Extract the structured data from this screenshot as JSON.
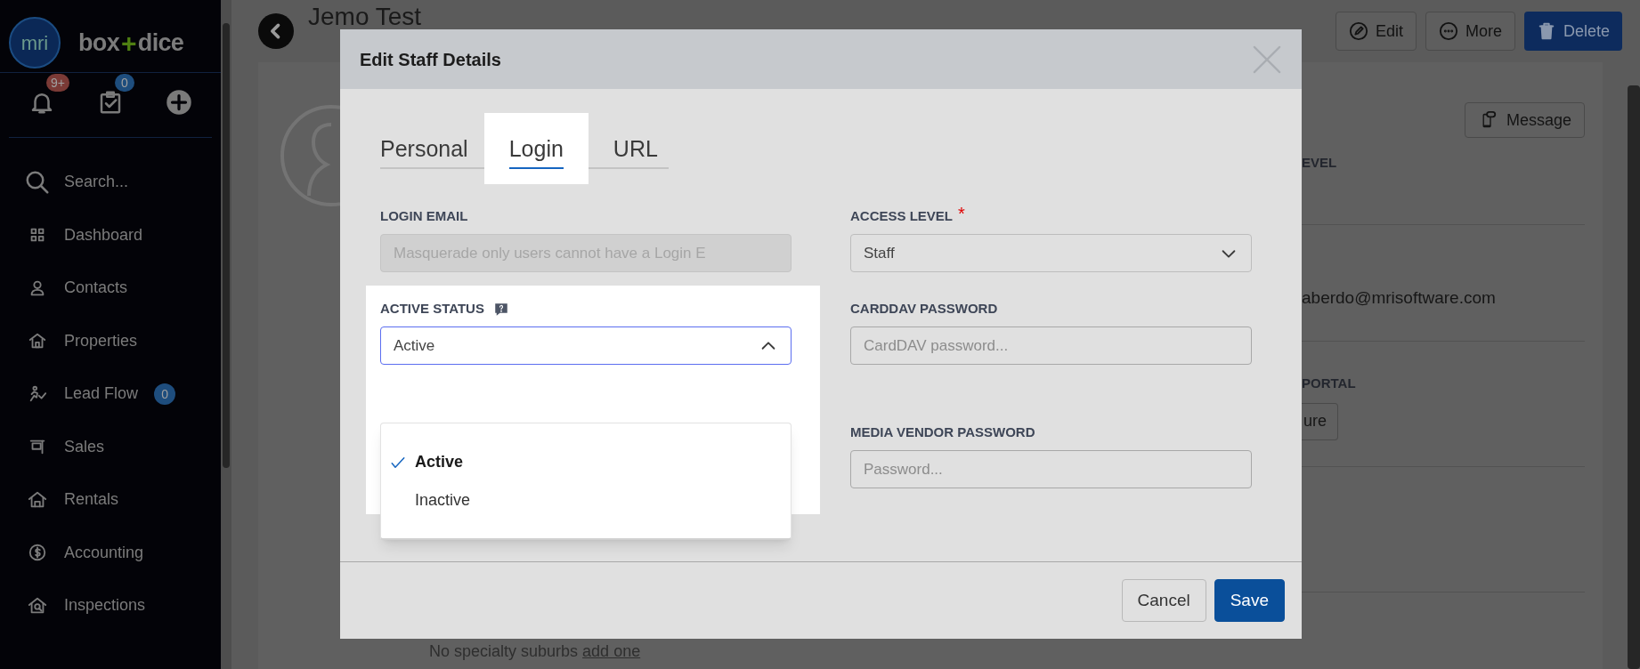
{
  "sidebar": {
    "logo": "mri",
    "brand": [
      {
        "text": "box",
        "color": "#7b7b7b"
      },
      {
        "text": "+",
        "color": "#4f7f12"
      },
      {
        "text": "dice",
        "color": "#7b7b7b"
      }
    ],
    "quick_actions": [
      {
        "kind": "bell",
        "badge": "9+",
        "color": "#7a3a36"
      },
      {
        "kind": "tasks",
        "badge": "0",
        "color": "#1e4d7d"
      },
      {
        "kind": "add"
      }
    ],
    "nav": [
      {
        "kind": "search",
        "label": "Search..."
      },
      {
        "kind": "dashboard",
        "label": "Dashboard"
      },
      {
        "kind": "contacts",
        "label": "Contacts"
      },
      {
        "kind": "properties",
        "label": "Properties"
      },
      {
        "kind": "leadflow",
        "label": "Lead Flow",
        "badge": "0"
      },
      {
        "kind": "sales",
        "label": "Sales"
      },
      {
        "kind": "rentals",
        "label": "Rentals"
      },
      {
        "kind": "accounting",
        "label": "Accounting"
      },
      {
        "kind": "inspections",
        "label": "Inspections"
      }
    ]
  },
  "page": {
    "title": "Jemo Test",
    "actions": [
      {
        "kind": "edit",
        "label": "Edit"
      },
      {
        "kind": "more",
        "label": "More"
      },
      {
        "kind": "delete",
        "label": "Delete"
      }
    ],
    "message_button": "Message",
    "sections": [
      {
        "label": "EVEL"
      },
      {
        "value": "aberdo@mrisoftware.com"
      },
      {
        "label": "PORTAL",
        "button": "ure"
      }
    ],
    "suburbs_text": "No specialty suburbs",
    "suburbs_link": "add one"
  },
  "modal": {
    "title": "Edit Staff Details",
    "tabs": [
      {
        "label": "Personal",
        "selected": false
      },
      {
        "label": "Login",
        "selected": true
      },
      {
        "label": "URL",
        "selected": false
      }
    ],
    "left_fields": [
      {
        "kind": "text",
        "label": "LOGIN EMAIL",
        "placeholder": "Masquerade only users cannot have a Login E",
        "disabled": true
      },
      {
        "kind": "select",
        "label": "ACTIVE STATUS",
        "help": true,
        "highlighted": true,
        "value": "Active",
        "expanded": true,
        "options": [
          {
            "label": "Active",
            "selected": true
          },
          {
            "label": "Inactive",
            "selected": false
          }
        ]
      }
    ],
    "right_fields": [
      {
        "kind": "select",
        "label": "ACCESS LEVEL",
        "required_mark": "*",
        "value": "Staff",
        "expanded": false
      },
      {
        "kind": "text",
        "label": "CARDDAV PASSWORD",
        "placeholder": "CardDAV password...",
        "disabled": false
      },
      {
        "kind": "text",
        "label": "MEDIA VENDOR PASSWORD",
        "placeholder": "Password...",
        "disabled": false
      }
    ],
    "buttons": [
      {
        "kind": "secondary",
        "label": "Cancel"
      },
      {
        "kind": "primary",
        "label": "Save"
      }
    ]
  }
}
